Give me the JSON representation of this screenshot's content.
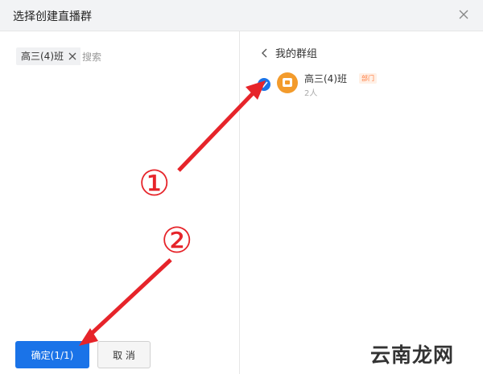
{
  "dialog": {
    "title": "选择创建直播群"
  },
  "left": {
    "selected_tag": "高三(4)班",
    "search_placeholder": "搜索"
  },
  "right": {
    "back_label": "我的群组",
    "group": {
      "name": "高三(4)班",
      "badge": "部门",
      "count": "2人",
      "checked": true
    }
  },
  "footer": {
    "confirm_label": "确定(1/1)",
    "cancel_label": "取 消"
  },
  "annotations": {
    "marker_1": "①",
    "marker_2": "②"
  },
  "watermark": "云南龙网",
  "colors": {
    "accent": "#1a73e8",
    "annotation": "#e6242a",
    "avatar": "#f39b2c"
  }
}
